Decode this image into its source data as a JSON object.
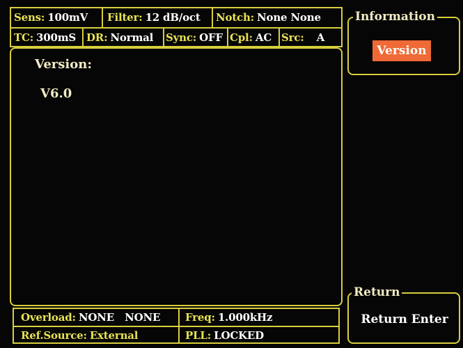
{
  "status_top": {
    "sens": {
      "label": "Sens:",
      "value": "100mV"
    },
    "filter": {
      "label": "Filter:",
      "value": "12 dB/oct"
    },
    "notch": {
      "label": "Notch:",
      "value": "None None"
    },
    "tc": {
      "label": "TC:",
      "value": "300mS"
    },
    "dr": {
      "label": "DR:",
      "value": "Normal"
    },
    "sync": {
      "label": "Sync:",
      "value": "OFF"
    },
    "cpl": {
      "label": "Cpl:",
      "value": "AC"
    },
    "src": {
      "label": "Src:",
      "value": "A"
    }
  },
  "main": {
    "heading": "Version:",
    "value": "V6.0"
  },
  "status_bottom": {
    "overload": {
      "label": "Overload:",
      "value": "NONE   NONE"
    },
    "freq": {
      "label": "Freq:",
      "value": "1.000kHz"
    },
    "ref_source": {
      "label": "Ref.Source:",
      "value": "External"
    },
    "pll": {
      "label": "PLL:",
      "value": "LOCKED"
    }
  },
  "side": {
    "information_title": "Information",
    "version_button": "Version",
    "return_title": "Return",
    "return_button": "Return Enter"
  },
  "colors": {
    "frame": "#d8cf3e",
    "label": "#e8e254",
    "button_bg": "#ef6a36",
    "background": "#060606"
  }
}
